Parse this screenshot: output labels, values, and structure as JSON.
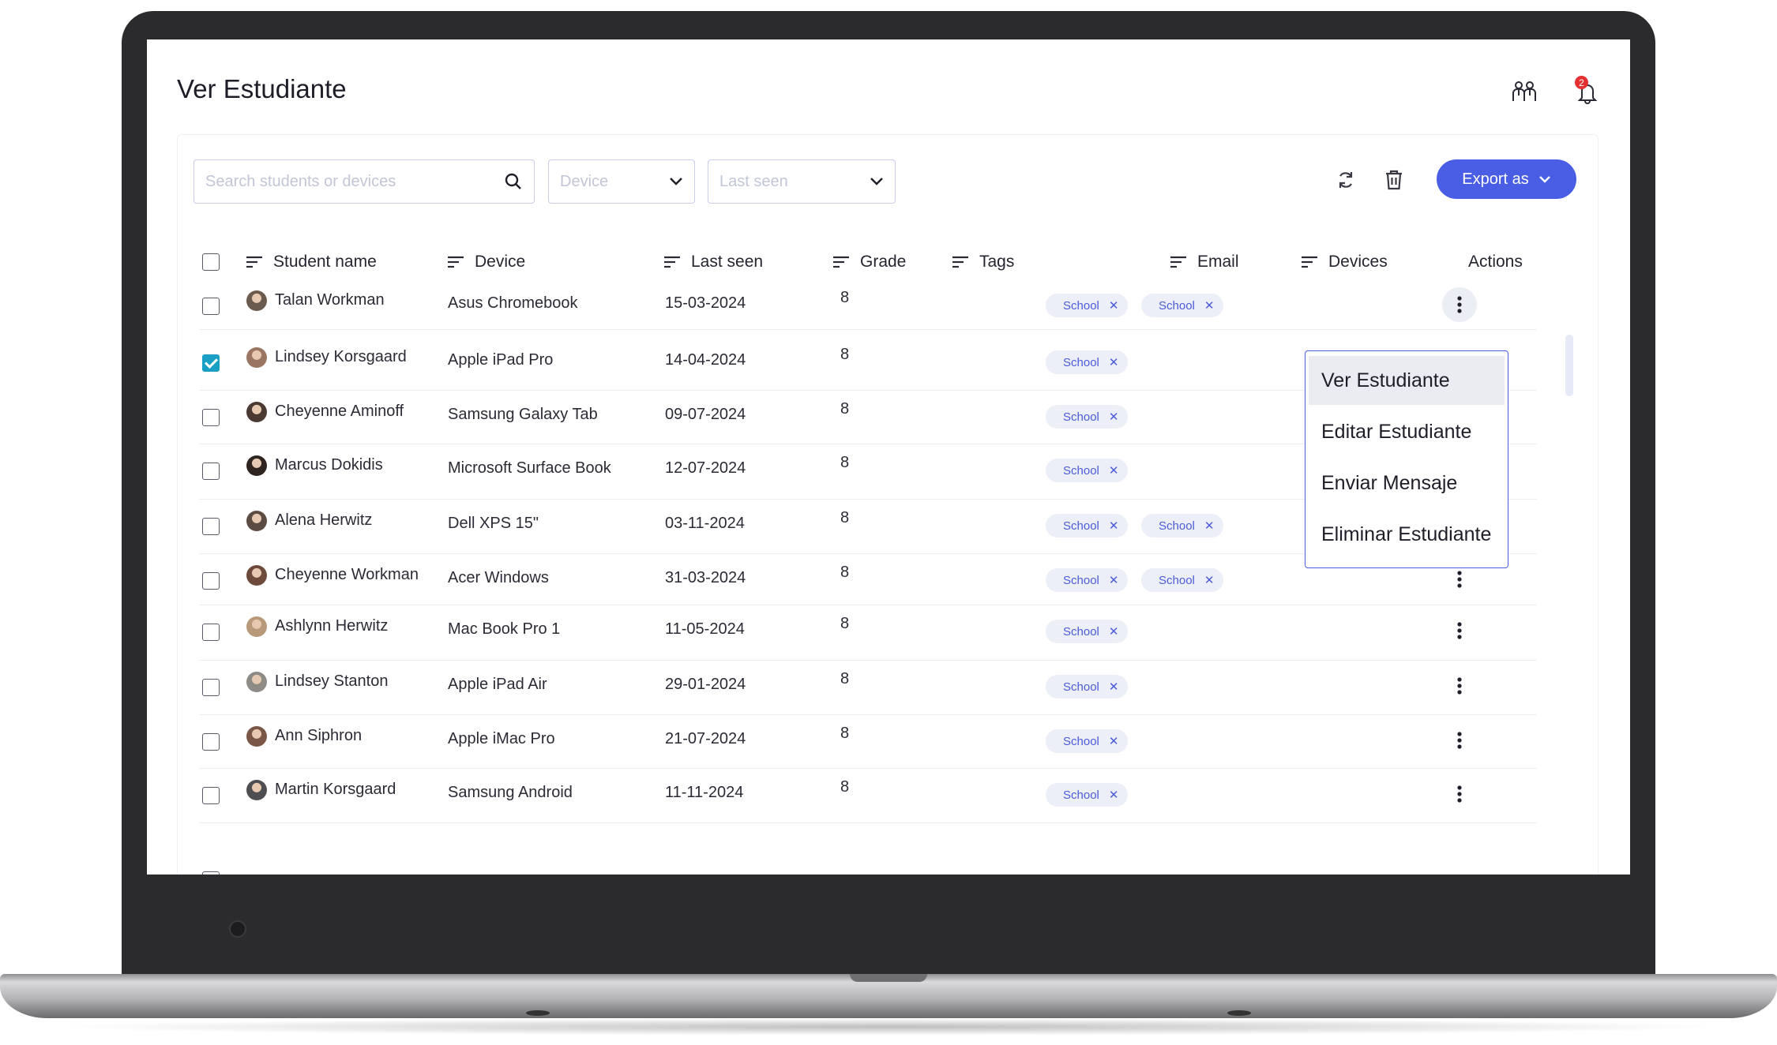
{
  "page": {
    "title": "Ver Estudiante",
    "notification_count": "2"
  },
  "toolbar": {
    "search_placeholder": "Search students or devices",
    "device_filter": "Device",
    "last_seen_filter": "Last seen",
    "export_label": "Export as"
  },
  "columns": {
    "student_name": "Student name",
    "device": "Device",
    "last_seen": "Last seen",
    "grade": "Grade",
    "tags": "Tags",
    "email": "Email",
    "devices": "Devices",
    "actions": "Actions"
  },
  "rows": [
    {
      "name": "Talan Workman",
      "device": "Asus Chromebook",
      "last_seen": "15-03-2024",
      "grade": "8",
      "tags": [
        "School",
        "School"
      ],
      "checked": false
    },
    {
      "name": "Lindsey Korsgaard",
      "device": "Apple iPad Pro",
      "last_seen": "14-04-2024",
      "grade": "8",
      "tags": [
        "School"
      ],
      "checked": true
    },
    {
      "name": "Cheyenne Aminoff",
      "device": "Samsung Galaxy Tab",
      "last_seen": "09-07-2024",
      "grade": "8",
      "tags": [
        "School"
      ],
      "checked": false
    },
    {
      "name": "Marcus Dokidis",
      "device": "Microsoft Surface Book",
      "last_seen": "12-07-2024",
      "grade": "8",
      "tags": [
        "School"
      ],
      "checked": false
    },
    {
      "name": "Alena Herwitz",
      "device": "Dell XPS 15\"",
      "last_seen": "03-11-2024",
      "grade": "8",
      "tags": [
        "School",
        "School"
      ],
      "checked": false
    },
    {
      "name": "Cheyenne Workman",
      "device": "Acer Windows",
      "last_seen": "31-03-2024",
      "grade": "8",
      "tags": [
        "School",
        "School"
      ],
      "checked": false
    },
    {
      "name": "Ashlynn Herwitz",
      "device": "Mac Book Pro 1",
      "last_seen": "11-05-2024",
      "grade": "8",
      "tags": [
        "School"
      ],
      "checked": false
    },
    {
      "name": "Lindsey Stanton",
      "device": "Apple iPad Air",
      "last_seen": "29-01-2024",
      "grade": "8",
      "tags": [
        "School"
      ],
      "checked": false
    },
    {
      "name": "Ann Siphron",
      "device": "Apple iMac Pro",
      "last_seen": "21-07-2024",
      "grade": "8",
      "tags": [
        "School"
      ],
      "checked": false
    },
    {
      "name": "Martin Korsgaard",
      "device": "Samsung Android",
      "last_seen": "11-11-2024",
      "grade": "8",
      "tags": [
        "School"
      ],
      "checked": false
    }
  ],
  "action_menu": {
    "items": [
      "Ver Estudiante",
      "Editar Estudiante",
      "Enviar Mensaje",
      "Eliminar Estudiante"
    ]
  },
  "colors": {
    "accent": "#4a5ee5",
    "checkbox_checked": "#1aa0c4",
    "tag_bg": "#eceff8",
    "badge": "#e43030"
  },
  "icons": {
    "search": "search-icon",
    "chevron": "chevron-down-icon",
    "refresh": "refresh-icon",
    "trash": "trash-icon",
    "students": "students-group-icon",
    "bell": "bell-icon",
    "sort": "sort-lines-icon",
    "more": "more-vertical-icon",
    "tag_remove": "close-icon"
  }
}
